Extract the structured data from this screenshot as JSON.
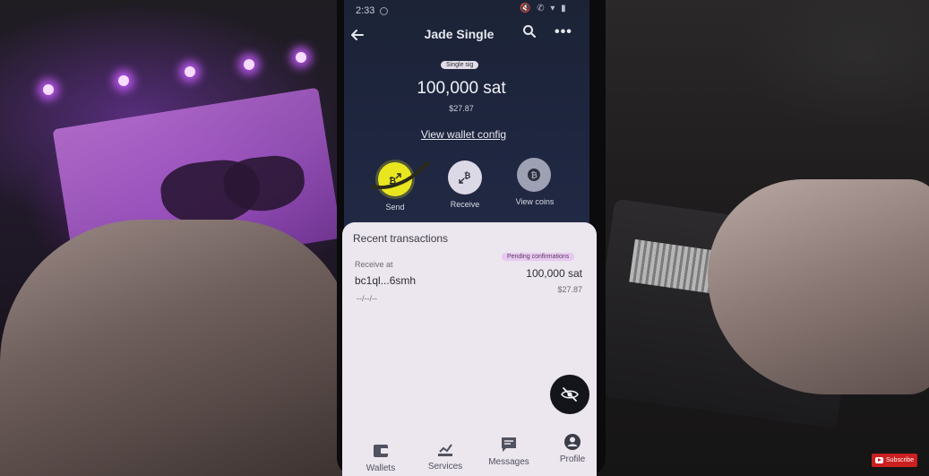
{
  "status_bar": {
    "time": "2:33",
    "icons": "🔇 ✆ ▾ ▮"
  },
  "app_bar": {
    "title": "Jade Single"
  },
  "wallet": {
    "sig_type": "Single sig",
    "balance": "100,000 sat",
    "fiat": "$27.87",
    "config_link": "View wallet config"
  },
  "actions": [
    {
      "label": "Send",
      "icon": "send-bitcoin-icon"
    },
    {
      "label": "Receive",
      "icon": "receive-bitcoin-icon"
    },
    {
      "label": "View coins",
      "icon": "coins-icon"
    }
  ],
  "transactions": {
    "title": "Recent transactions",
    "items": [
      {
        "type": "Receive at",
        "address": "bc1ql...6smh",
        "status": "Pending confirmations",
        "amount": "100,000 sat",
        "fiat": "$27.87",
        "date": "--/--/--"
      }
    ]
  },
  "fab": {
    "icon": "eye-off-icon"
  },
  "bottom_nav": [
    {
      "label": "Wallets",
      "icon": "wallet-icon"
    },
    {
      "label": "Services",
      "icon": "services-icon"
    },
    {
      "label": "Messages",
      "icon": "messages-icon"
    },
    {
      "label": "Profile",
      "icon": "profile-icon"
    }
  ],
  "overlay": {
    "subscribe_label": "Subscribe"
  },
  "colors": {
    "header_bg": "#1e2640",
    "sheet_bg": "#ece6ee",
    "send_accent": "#e9e620",
    "pending_badge": "#e8c9ef",
    "subscribe_red": "#cc1f1f"
  }
}
